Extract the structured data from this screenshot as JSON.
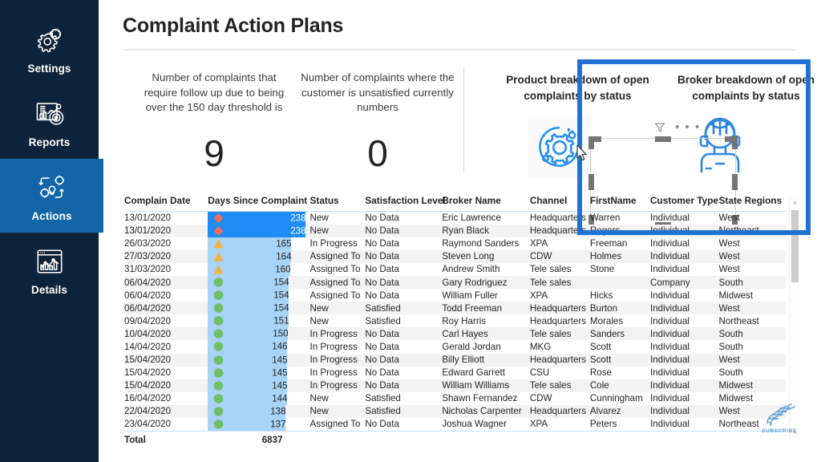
{
  "sidebar": {
    "background_color": "#0d2339",
    "active_color": "#1266a8",
    "items": [
      {
        "label": "Settings",
        "icon": "gear-icon",
        "active": false
      },
      {
        "label": "Reports",
        "icon": "report-chart-icon",
        "active": false
      },
      {
        "label": "Actions",
        "icon": "workflow-gear-icon",
        "active": true
      },
      {
        "label": "Details",
        "icon": "browser-chart-icon",
        "active": false
      }
    ]
  },
  "header": {
    "title": "Complaint Action Plans"
  },
  "kpi_cards": [
    {
      "caption": "Number of complaints that require follow up due to being over the 150 day threshold is",
      "value": "9"
    },
    {
      "caption": "Number of complaints where the customer is unsatisfied currently numbers",
      "value": "0"
    }
  ],
  "charts": [
    {
      "title": "Product breakdown of open complaints by status",
      "icon": "gear-placeholder-icon"
    },
    {
      "title": "Broker breakdown of open complaints by status",
      "icon": "headset-agent-icon"
    }
  ],
  "visual_toolbar": {
    "filter_icon": "filter-funnel-icon",
    "more_options": "• • •"
  },
  "highlight_box": {
    "color": "#1f72d4"
  },
  "table": {
    "columns": [
      "Complain Date",
      "Days Since Complaint",
      "Status",
      "Satisfaction Level",
      "Broker Name",
      "Channel",
      "FirstName",
      "Customer Type",
      "State Regions"
    ],
    "marker_colors": {
      "red": "#e8705a",
      "orange": "#f5b33c",
      "green": "#6fbf6a"
    },
    "bar_colors": {
      "normal": "#a8d4f7",
      "selected": "#1f8df5"
    },
    "max_days": 238,
    "rows": [
      {
        "date": "13/01/2020",
        "days": 238,
        "marker": "red",
        "selected": true,
        "status": "New",
        "satisfaction": "No Data",
        "broker": "Eric Lawrence",
        "channel": "Headquarters",
        "firstname": "Warren",
        "customer_type": "Individual",
        "state_region": "West"
      },
      {
        "date": "13/01/2020",
        "days": 238,
        "marker": "red",
        "selected": true,
        "status": "New",
        "satisfaction": "No Data",
        "broker": "Ryan Black",
        "channel": "Headquarters",
        "firstname": "Rogers",
        "customer_type": "Individual",
        "state_region": "Northeast"
      },
      {
        "date": "26/03/2020",
        "days": 165,
        "marker": "orange",
        "selected": false,
        "status": "In Progress",
        "satisfaction": "No Data",
        "broker": "Raymond Sanders",
        "channel": "XPA",
        "firstname": "Freeman",
        "customer_type": "Individual",
        "state_region": "West"
      },
      {
        "date": "27/03/2020",
        "days": 164,
        "marker": "orange",
        "selected": false,
        "status": "Assigned To",
        "satisfaction": "No Data",
        "broker": "Steven Long",
        "channel": "CDW",
        "firstname": "Holmes",
        "customer_type": "Individual",
        "state_region": "West"
      },
      {
        "date": "31/03/2020",
        "days": 160,
        "marker": "orange",
        "selected": false,
        "status": "Assigned To",
        "satisfaction": "No Data",
        "broker": "Andrew Smith",
        "channel": "Tele sales",
        "firstname": "Stone",
        "customer_type": "Individual",
        "state_region": "West"
      },
      {
        "date": "06/04/2020",
        "days": 154,
        "marker": "green",
        "selected": false,
        "status": "Assigned To",
        "satisfaction": "No Data",
        "broker": "Gary Rodriguez",
        "channel": "Tele sales",
        "firstname": "",
        "customer_type": "Company",
        "state_region": "South"
      },
      {
        "date": "06/04/2020",
        "days": 154,
        "marker": "green",
        "selected": false,
        "status": "Assigned To",
        "satisfaction": "No Data",
        "broker": "William Fuller",
        "channel": "XPA",
        "firstname": "Hicks",
        "customer_type": "Individual",
        "state_region": "Midwest"
      },
      {
        "date": "06/04/2020",
        "days": 154,
        "marker": "green",
        "selected": false,
        "status": "New",
        "satisfaction": "Satisfied",
        "broker": "Todd Freeman",
        "channel": "Headquarters",
        "firstname": "Burton",
        "customer_type": "Individual",
        "state_region": "West"
      },
      {
        "date": "09/04/2020",
        "days": 151,
        "marker": "green",
        "selected": false,
        "status": "New",
        "satisfaction": "Satisfied",
        "broker": "Roy Harris",
        "channel": "Headquarters",
        "firstname": "Morales",
        "customer_type": "Individual",
        "state_region": "Northeast"
      },
      {
        "date": "10/04/2020",
        "days": 150,
        "marker": "green",
        "selected": false,
        "status": "In Progress",
        "satisfaction": "No Data",
        "broker": "Carl Hayes",
        "channel": "Tele sales",
        "firstname": "Sanders",
        "customer_type": "Individual",
        "state_region": "South"
      },
      {
        "date": "14/04/2020",
        "days": 146,
        "marker": "green",
        "selected": false,
        "status": "In Progress",
        "satisfaction": "No Data",
        "broker": "Gerald Jordan",
        "channel": "MKG",
        "firstname": "Scott",
        "customer_type": "Individual",
        "state_region": "South"
      },
      {
        "date": "15/04/2020",
        "days": 145,
        "marker": "green",
        "selected": false,
        "status": "In Progress",
        "satisfaction": "No Data",
        "broker": "Billy Elliott",
        "channel": "Headquarters",
        "firstname": "Scott",
        "customer_type": "Individual",
        "state_region": "West"
      },
      {
        "date": "15/04/2020",
        "days": 145,
        "marker": "green",
        "selected": false,
        "status": "In Progress",
        "satisfaction": "No Data",
        "broker": "Edward Garrett",
        "channel": "CSU",
        "firstname": "Rose",
        "customer_type": "Individual",
        "state_region": "South"
      },
      {
        "date": "15/04/2020",
        "days": 145,
        "marker": "green",
        "selected": false,
        "status": "In Progress",
        "satisfaction": "No Data",
        "broker": "William Williams",
        "channel": "Tele sales",
        "firstname": "Cole",
        "customer_type": "Individual",
        "state_region": "Midwest"
      },
      {
        "date": "16/04/2020",
        "days": 144,
        "marker": "green",
        "selected": false,
        "status": "New",
        "satisfaction": "Satisfied",
        "broker": "Shawn Fernandez",
        "channel": "CDW",
        "firstname": "Cunningham",
        "customer_type": "Individual",
        "state_region": "Midwest"
      },
      {
        "date": "22/04/2020",
        "days": 138,
        "marker": "green",
        "selected": false,
        "status": "New",
        "satisfaction": "Satisfied",
        "broker": "Nicholas Carpenter",
        "channel": "Headquarters",
        "firstname": "Alvarez",
        "customer_type": "Individual",
        "state_region": "West"
      },
      {
        "date": "23/04/2020",
        "days": 137,
        "marker": "green",
        "selected": false,
        "status": "Assigned To",
        "satisfaction": "No Data",
        "broker": "Joshua Wagner",
        "channel": "XPA",
        "firstname": "Peters",
        "customer_type": "Individual",
        "state_region": "Northeast"
      }
    ],
    "total_label": "Total",
    "total_days": "6837"
  },
  "scrollbar": {
    "up_arrow": "˄",
    "down_arrow": "˅"
  },
  "watermark": {
    "text": "SUBSCRIBE",
    "icon": "dna-helix-icon"
  }
}
